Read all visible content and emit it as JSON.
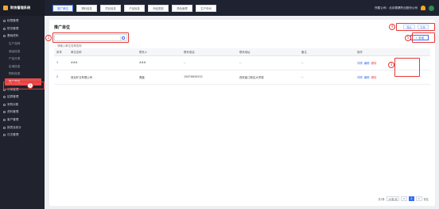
{
  "app": {
    "title": "财务管理系统"
  },
  "sidebar": {
    "items": [
      {
        "label": "权限管理",
        "level": 1
      },
      {
        "label": "财务管理",
        "level": 1
      },
      {
        "label": "基础资料",
        "level": 1
      },
      {
        "label": "生产品种",
        "level": 2
      },
      {
        "label": "商品信息",
        "level": 2
      },
      {
        "label": "产品分类",
        "level": 2
      },
      {
        "label": "区域信息",
        "level": 2
      },
      {
        "label": "物料信息",
        "level": 2
      },
      {
        "label": "推广单位",
        "level": 2,
        "active": true
      },
      {
        "label": "订单管理",
        "level": 1
      },
      {
        "label": "结算管理",
        "level": 1
      },
      {
        "label": "采购对账",
        "level": 1
      },
      {
        "label": "资料管理",
        "level": 1
      },
      {
        "label": "客户管理",
        "level": 1
      },
      {
        "label": "报表及统计",
        "level": 1
      },
      {
        "label": "日志管理",
        "level": 1
      }
    ]
  },
  "topbar": {
    "tabs": [
      {
        "label": "推广单位",
        "active": true
      },
      {
        "label": "物料信息"
      },
      {
        "label": "项目信息"
      },
      {
        "label": "产品信息"
      },
      {
        "label": "商品类型"
      },
      {
        "label": "角色管理"
      },
      {
        "label": "生产车间"
      }
    ],
    "user": "所属公司：北京德健药业股份公司"
  },
  "page": {
    "title": "推广单位",
    "search_placeholder": "请输入单位名称查询",
    "import_label": "导出",
    "print_label": "打印",
    "add_label": "+ 新增"
  },
  "table": {
    "headers": [
      "序号",
      "单位名称",
      "联系人",
      "联系电话",
      "联系地址",
      "备注",
      "操作"
    ],
    "rows": [
      [
        "1",
        "###",
        "###",
        "--",
        "--",
        "--"
      ],
      [
        "2",
        "西北矿业有限公司",
        "周磊",
        "15876630532",
        "西安曲江新区大学城",
        "--"
      ]
    ],
    "ops": [
      "详情",
      "编辑",
      "删除"
    ]
  },
  "pager": {
    "total": "共2条",
    "page_size": "10条/页",
    "prev": "<",
    "current": "1",
    "next": ">",
    "goto": "前往"
  },
  "annotations": [
    "1",
    "2",
    "3",
    "4",
    "5"
  ]
}
